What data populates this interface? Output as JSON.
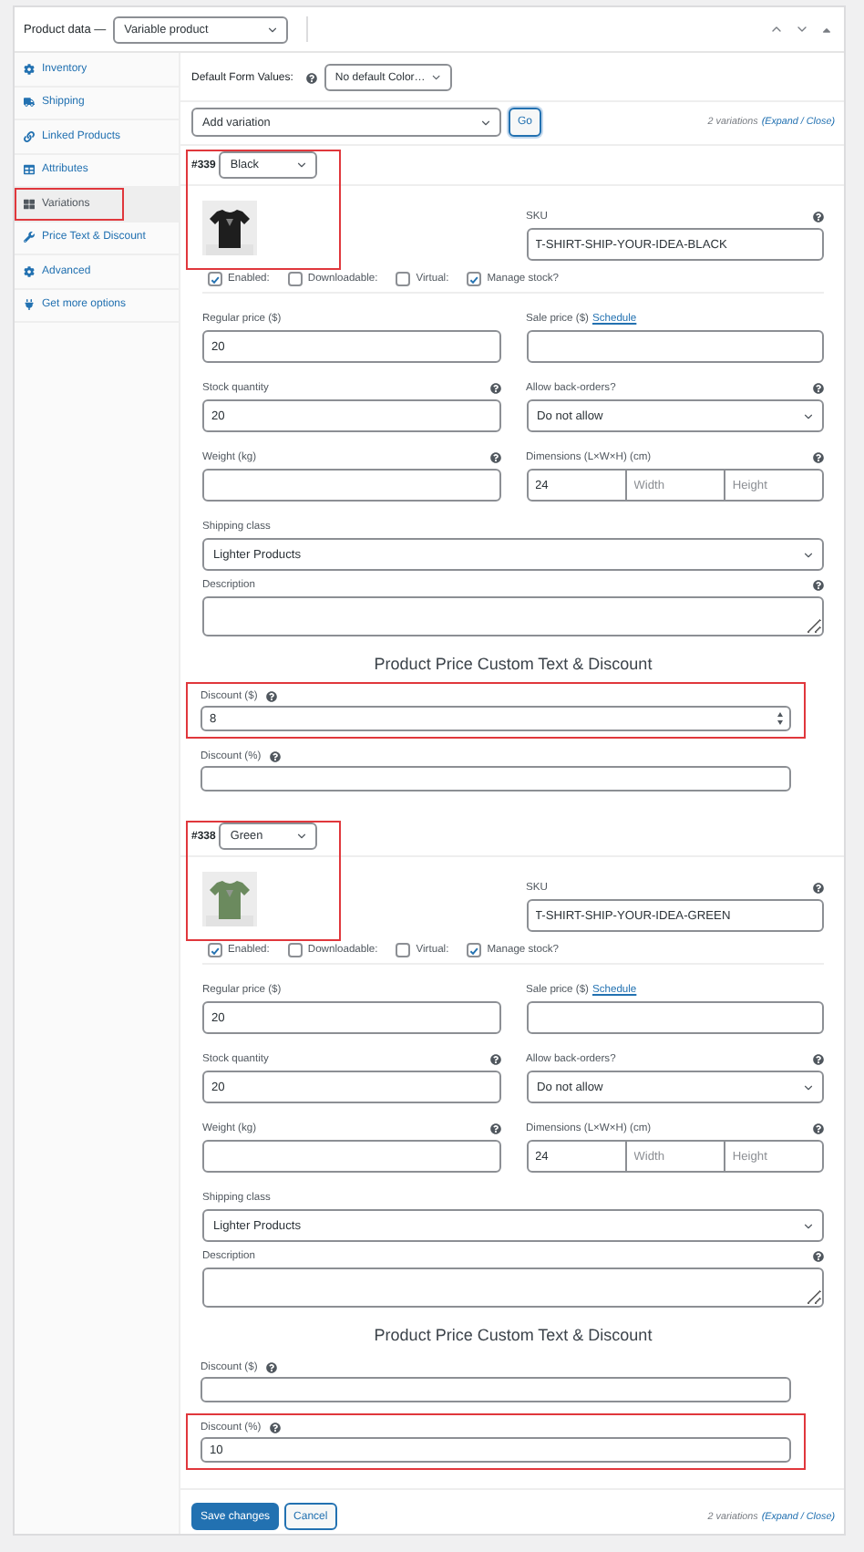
{
  "header": {
    "title": "Product data —",
    "product_type": "Variable product"
  },
  "sidebar": {
    "items": [
      {
        "label": "Inventory",
        "selected": false,
        "highlighted": false
      },
      {
        "label": "Shipping",
        "selected": false,
        "highlighted": false
      },
      {
        "label": "Linked Products",
        "selected": false,
        "highlighted": false
      },
      {
        "label": "Attributes",
        "selected": false,
        "highlighted": false
      },
      {
        "label": "Variations",
        "selected": true,
        "highlighted": true
      },
      {
        "label": "Price Text & Discount",
        "selected": false,
        "highlighted": false
      },
      {
        "label": "Advanced",
        "selected": false,
        "highlighted": false
      },
      {
        "label": "Get more options",
        "selected": false,
        "highlighted": false
      }
    ]
  },
  "defaults": {
    "label": "Default Form Values:",
    "value": "No default Color…"
  },
  "toolbar": {
    "action": "Add variation",
    "button": "Go",
    "count": "2 variations",
    "links": "(Expand / Close)"
  },
  "variations": [
    {
      "id": "#339",
      "attribute": "Black",
      "highlighted": true,
      "sku_label": "SKU",
      "sku": "T-SHIRT-SHIP-YOUR-IDEA-BLACK",
      "options": [
        {
          "label": "Enabled:",
          "checked": true
        },
        {
          "label": "Downloadable:",
          "checked": false
        },
        {
          "label": "Virtual:",
          "checked": false
        },
        {
          "label": "Manage stock?",
          "checked": true
        }
      ],
      "fields": [
        {
          "kind": "text",
          "label": "Regular price ($)",
          "value": "20",
          "help": false,
          "full_width": false
        },
        {
          "kind": "text",
          "label": "Sale price ($)",
          "link": "Schedule",
          "help": false,
          "full_width": false
        },
        {
          "kind": "text",
          "label": "Stock quantity",
          "value": "20",
          "help": true,
          "full_width": false
        },
        {
          "kind": "select",
          "label": "Allow back-orders?",
          "value": "Do not allow",
          "help": true,
          "full_width": false
        },
        {
          "kind": "text",
          "label": "Weight (kg)",
          "help": true,
          "full_width": false
        },
        {
          "kind": "dimensions",
          "label": "Dimensions (L×W×H) (cm)",
          "value": "24",
          "placeholders": [
            "Width",
            "Height"
          ],
          "help": true,
          "full_width": false
        },
        {
          "kind": "select",
          "label": "Shipping class",
          "value": "Lighter Products",
          "help": false,
          "full_width": true
        },
        {
          "kind": "textarea",
          "label": "Description",
          "help": true,
          "full_width": true
        }
      ],
      "discount_title": "Product Price Custom Text & Discount",
      "discounts": [
        {
          "kind": "number",
          "label": "Discount ($)",
          "value": "8",
          "highlighted": true
        },
        {
          "kind": "text",
          "label": "Discount (%)",
          "highlighted": false
        }
      ]
    },
    {
      "id": "#338",
      "attribute": "Green",
      "highlighted": true,
      "sku_label": "SKU",
      "sku": "T-SHIRT-SHIP-YOUR-IDEA-GREEN",
      "options": [
        {
          "label": "Enabled:",
          "checked": true
        },
        {
          "label": "Downloadable:",
          "checked": false
        },
        {
          "label": "Virtual:",
          "checked": false
        },
        {
          "label": "Manage stock?",
          "checked": true
        }
      ],
      "fields": [
        {
          "kind": "text",
          "label": "Regular price ($)",
          "value": "20",
          "help": false,
          "full_width": false
        },
        {
          "kind": "text",
          "label": "Sale price ($)",
          "link": "Schedule",
          "help": false,
          "full_width": false
        },
        {
          "kind": "text",
          "label": "Stock quantity",
          "value": "20",
          "help": true,
          "full_width": false
        },
        {
          "kind": "select",
          "label": "Allow back-orders?",
          "value": "Do not allow",
          "help": true,
          "full_width": false
        },
        {
          "kind": "text",
          "label": "Weight (kg)",
          "help": true,
          "full_width": false
        },
        {
          "kind": "dimensions",
          "label": "Dimensions (L×W×H) (cm)",
          "value": "24",
          "placeholders": [
            "Width",
            "Height"
          ],
          "help": true,
          "full_width": false
        },
        {
          "kind": "select",
          "label": "Shipping class",
          "value": "Lighter Products",
          "help": false,
          "full_width": true
        },
        {
          "kind": "textarea",
          "label": "Description",
          "help": true,
          "full_width": true
        }
      ],
      "discount_title": "Product Price Custom Text & Discount",
      "discounts": [
        {
          "kind": "text",
          "label": "Discount ($)",
          "highlighted": false
        },
        {
          "kind": "text",
          "label": "Discount (%)",
          "value": "10",
          "highlighted": true
        }
      ]
    }
  ],
  "footer": {
    "buttons": [
      {
        "label": "Save changes",
        "kind": "primary"
      },
      {
        "label": "Cancel",
        "kind": "secondary"
      }
    ],
    "count": "2 variations",
    "links": "(Expand / Close)"
  }
}
